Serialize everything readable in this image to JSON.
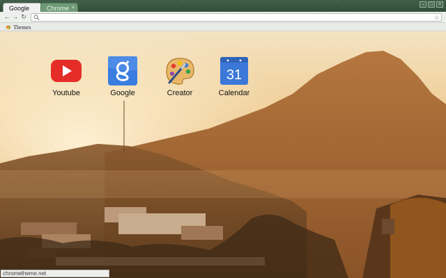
{
  "tabs": [
    {
      "label": "Google",
      "active": true
    },
    {
      "label": "Chrome",
      "active": false,
      "close": "×"
    }
  ],
  "window_controls": {
    "minimize": "–",
    "maximize": "□",
    "close": "×"
  },
  "toolbar": {
    "back_icon": "←",
    "forward_icon": "→",
    "reload_icon": "↻",
    "address_value": "",
    "star_icon": "☆"
  },
  "bookmarks": {
    "items": [
      {
        "label": "Themes",
        "icon": "paint-palette-icon"
      }
    ]
  },
  "apps": [
    {
      "label": "Youtube",
      "icon": "youtube-icon"
    },
    {
      "label": "Google",
      "icon": "google-icon"
    },
    {
      "label": "Creator",
      "icon": "creator-palette-icon"
    },
    {
      "label": "Calendar",
      "icon": "calendar-icon",
      "day": "31"
    }
  ],
  "status_bar": {
    "text": "chrometheme.net"
  },
  "colors": {
    "frame": "#2f4a36",
    "tab_inactive": "#6f9a76",
    "youtube_red": "#e52d27",
    "google_blue": "#3a7de0",
    "calendar_blue": "#3b78d8"
  }
}
